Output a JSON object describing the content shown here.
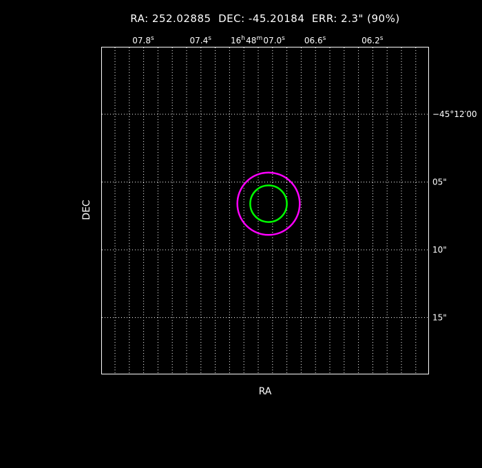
{
  "header": {
    "title": "RA: 252.02885  DEC: -45.20184  ERR: 2.3\" (90%)"
  },
  "chart_data": {
    "type": "scatter",
    "title": "RA: 252.02885  DEC: -45.20184  ERR: 2.3\" (90%)",
    "xlabel": "RA",
    "ylabel": "DEC",
    "ra_center_deg": 252.02885,
    "dec_center_deg": -45.20184,
    "error_radius_arcsec": 2.3,
    "confidence": "90%",
    "x_ticks": [
      {
        "value_s": 7.8,
        "label": "07.8",
        "sup": "s"
      },
      {
        "value_s": 7.4,
        "label": "07.4",
        "sup": "s"
      },
      {
        "value_s": 7.0,
        "label": "16",
        "sup": "h",
        "label2": "48",
        "sup2": "m",
        "label3": "07.0",
        "sup3": "s"
      },
      {
        "value_s": 6.6,
        "label": "06.6",
        "sup": "s"
      },
      {
        "value_s": 6.2,
        "label": "06.2",
        "sup": "s"
      }
    ],
    "y_ticks": [
      {
        "value_arcsec": 0,
        "label": "−45°12′00"
      },
      {
        "value_arcsec": 5,
        "label": "05\""
      },
      {
        "value_arcsec": 10,
        "label": "10\""
      },
      {
        "value_arcsec": 15,
        "label": "15\""
      }
    ],
    "circles": [
      {
        "name": "",
        "radius_arcsec": 2.3,
        "color": "#ff00ff"
      },
      {
        "name": "",
        "radius_arcsec": 1.35,
        "color": "#00ff00"
      }
    ],
    "grid": true,
    "colors": {
      "background": "#000000",
      "frame": "#ffffff",
      "grid": "#ffffff"
    }
  }
}
